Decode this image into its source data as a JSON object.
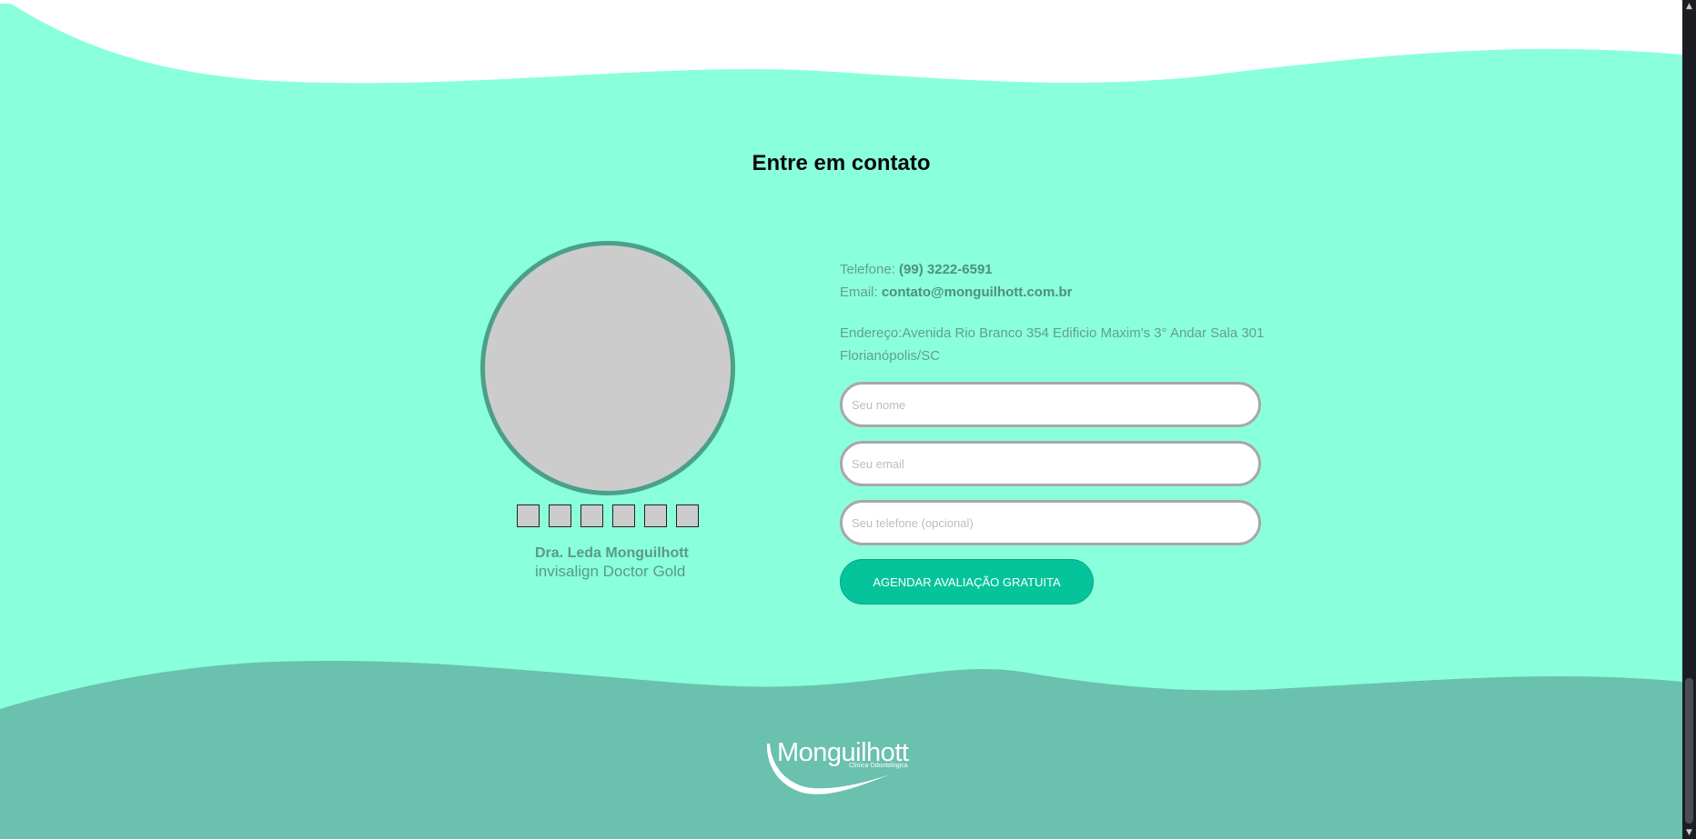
{
  "contact": {
    "title": "Entre em contato",
    "phone_label": "Telefone: ",
    "phone_value": "(99) 3222-6591",
    "email_label": "Email: ",
    "email_value": "contato@monguilhott.com.br",
    "address_line1": "Endereço:Avenida Rio Branco 354 Edificio Maxim's 3° Andar Sala 301",
    "address_line2": "Florianópolis/SC"
  },
  "doctor": {
    "name": "Dra. Leda Monguilhott",
    "title": "invisalign Doctor Gold",
    "thumbnail_count": 6
  },
  "form": {
    "name_placeholder": "Seu nome",
    "email_placeholder": "Seu email",
    "phone_placeholder": "Seu telefone (opcional)",
    "submit_label": "AGENDAR AVALIAÇÃO GRATUITA"
  },
  "footer": {
    "logo_name": "Monguilhott",
    "logo_subtitle": "Clínica Odontológica"
  },
  "colors": {
    "background": "#8affdb",
    "footer_wave": "#69c1ae",
    "accent": "#05c49b",
    "photo_border": "#4aa088"
  },
  "scrollbar": {
    "up_icon": "arrow-up-icon",
    "down_icon": "arrow-down-icon"
  }
}
